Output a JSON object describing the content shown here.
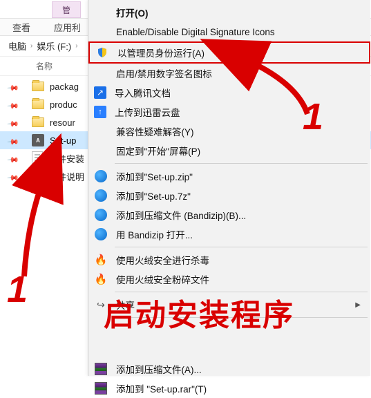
{
  "ribbon": {
    "context_tab": "管",
    "view": "查看",
    "app": "应用利"
  },
  "breadcrumb": {
    "pc": "电脑",
    "drive": "娱乐 (F:)"
  },
  "columns": {
    "name": "名称"
  },
  "files": [
    {
      "label": "packag",
      "type": "folder"
    },
    {
      "label": "produc",
      "type": "folder"
    },
    {
      "label": "resour",
      "type": "folder"
    },
    {
      "label": "Set-up",
      "type": "exe",
      "selected": true
    },
    {
      "label": "软件安装",
      "type": "txt"
    },
    {
      "label": "软件说明",
      "type": "txt"
    }
  ],
  "menu": {
    "open": "打开(O)",
    "sig_icons": "Enable/Disable Digital Signature Icons",
    "run_admin": "以管理员身份运行(A)",
    "sig_zh": "启用/禁用数字签名图标",
    "tencent": "导入腾讯文档",
    "xunlei": "上传到迅雷云盘",
    "compat": "兼容性疑难解答(Y)",
    "pin_start": "固定到\"开始\"屏幕(P)",
    "bz_zip": "添加到\"Set-up.zip\"",
    "bz_7z": "添加到\"Set-up.7z\"",
    "bz_b": "添加到压缩文件 (Bandizip)(B)...",
    "bz_open": "用 Bandizip 打开...",
    "hr_scan": "使用火绒安全进行杀毒",
    "hr_shred": "使用火绒安全粉碎文件",
    "share": "共享",
    "rar_a": "添加到压缩文件(A)...",
    "rar_setup": "添加到 \"Set-up.rar\"(T)"
  },
  "annot": {
    "one_a": "1",
    "one_b": "1",
    "caption": "启动安装程序"
  }
}
